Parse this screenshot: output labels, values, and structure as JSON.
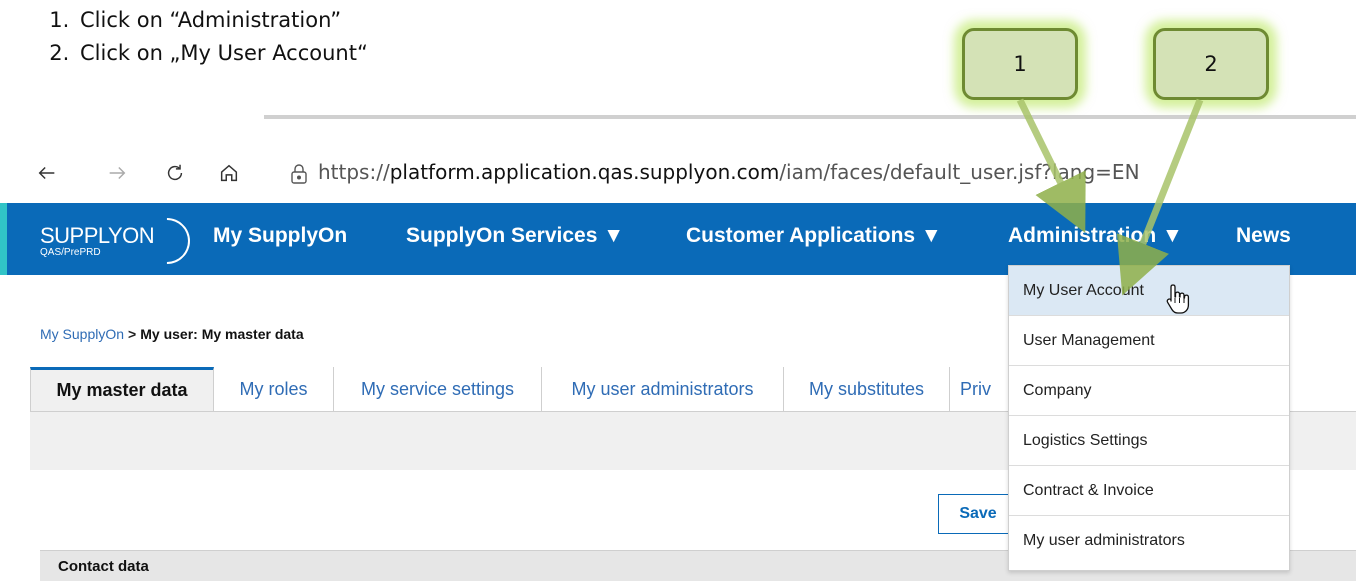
{
  "instructions": [
    "Click on “Administration”",
    "Click on „My User Account“"
  ],
  "callouts": [
    "1",
    "2"
  ],
  "browser": {
    "url_prefix": "https://",
    "url_host": "platform.application.qas.supplyon.com",
    "url_path": "/iam/faces/default_user.jsf?lang=EN"
  },
  "logo": {
    "main": "SUPPLYON",
    "sub": "QAS/PrePRD"
  },
  "navbar": {
    "items": [
      "My SupplyOn",
      "SupplyOn Services ▼",
      "Customer Applications ▼",
      "Administration ▼",
      "News"
    ]
  },
  "breadcrumb": {
    "link": "My SupplyOn",
    "separator": ">",
    "current": "My user: My master data"
  },
  "tabs": [
    "My master data",
    "My roles",
    "My service settings",
    "My user administrators",
    "My substitutes",
    "Priv"
  ],
  "dropdown": {
    "items": [
      "My User Account",
      "User Management",
      "Company",
      "Logistics Settings",
      "Contract & Invoice",
      "My user administrators"
    ]
  },
  "form": {
    "save_label": "Save",
    "section_title": "Contact data"
  },
  "colors": {
    "brand_blue": "#0a6ab8",
    "accent_teal": "#31c4c7",
    "callout_fill": "#d4e2b6",
    "callout_border": "#6e8a32",
    "arrow": "#8fb04a",
    "hover": "#dbe8f4"
  }
}
